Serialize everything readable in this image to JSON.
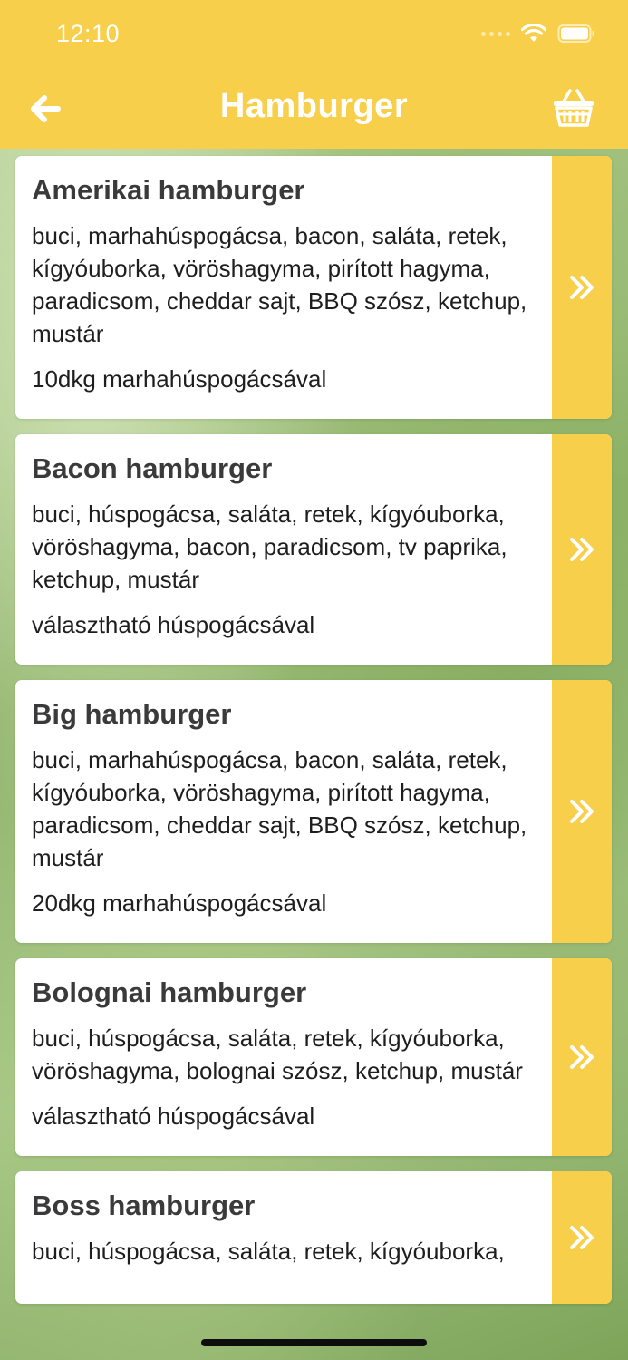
{
  "status_bar": {
    "time": "12:10"
  },
  "nav": {
    "title": "Hamburger",
    "back_icon": "arrow-left-icon",
    "cart_icon": "basket-icon"
  },
  "colors": {
    "accent": "#f8cf4b",
    "card_bg": "#ffffff",
    "title_text": "#3a3a3a",
    "body_text": "#1e1e1e"
  },
  "products": [
    {
      "name": "Amerikai hamburger",
      "ingredients": "buci, marhahúspogácsa, bacon, saláta, retek, kígyóuborka, vöröshagyma, pirított hagyma, paradicsom, cheddar sajt, BBQ szósz, ketchup, mustár",
      "note": "10dkg marhahúspogácsával"
    },
    {
      "name": "Bacon hamburger",
      "ingredients": "buci, húspogácsa, saláta, retek, kígyóuborka, vöröshagyma, bacon, paradicsom, tv paprika, ketchup, mustár",
      "note": "választható húspogácsával"
    },
    {
      "name": "Big hamburger",
      "ingredients": "buci, marhahúspogácsa, bacon, saláta, retek, kígyóuborka, vöröshagyma, pirított hagyma, paradicsom, cheddar sajt, BBQ szósz, ketchup, mustár",
      "note": "20dkg marhahúspogácsával"
    },
    {
      "name": "Bolognai hamburger",
      "ingredients": "buci, húspogácsa, saláta, retek, kígyóuborka, vöröshagyma, bolognai szósz, ketchup, mustár",
      "note": "választható húspogácsával"
    },
    {
      "name": "Boss hamburger",
      "ingredients": "buci, húspogácsa, saláta, retek, kígyóuborka,",
      "note": ""
    }
  ]
}
